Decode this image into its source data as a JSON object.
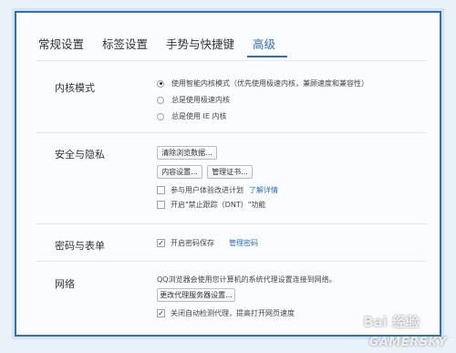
{
  "tabs": [
    {
      "label": "常规设置"
    },
    {
      "label": "标签设置"
    },
    {
      "label": "手势与快捷键"
    },
    {
      "label": "高级"
    }
  ],
  "kernel": {
    "title": "内核模式",
    "options": [
      {
        "label": "使用智能内核模式（优先使用极速内核，兼顾速度和兼容性）",
        "checked": true
      },
      {
        "label": "总是使用极速内核",
        "checked": false
      },
      {
        "label": "总是使用 IE 内核",
        "checked": false
      }
    ]
  },
  "security": {
    "title": "安全与隐私",
    "clear_button": "清除浏览数据...",
    "content_button": "内容设置...",
    "cert_button": "管理证书...",
    "experience_label": "参与用户体验改进计划",
    "experience_link": "了解详情",
    "dnt_label": "开启\"禁止跟踪（DNT）\"功能"
  },
  "passwords": {
    "title": "密码与表单",
    "save_label": "开启密码保存",
    "manage_link": "管理密码"
  },
  "network": {
    "title": "网络",
    "description": "QQ浏览器会使用您计算机的系统代理设置连接到网络。",
    "proxy_button": "更改代理服务器设置...",
    "auto_detect_label": "关闭自动检测代理，提高打开网页速度"
  },
  "watermark": {
    "text1": "Bai 经验",
    "text2": "GAMERSKY"
  }
}
